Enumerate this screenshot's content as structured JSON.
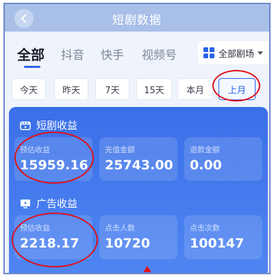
{
  "header": {
    "title": "短剧数据"
  },
  "platform_tabs": [
    "全部",
    "抖音",
    "快手",
    "视频号"
  ],
  "active_platform": "全部",
  "theater_select": {
    "value": "全部剧场",
    "icon": "grid-icon"
  },
  "time_tabs": [
    "今天",
    "昨天",
    "7天",
    "15天",
    "本月",
    "上月"
  ],
  "active_time_tab": "上月",
  "drama_income": {
    "title": "短剧收益",
    "icon": "film-icon",
    "metrics": [
      {
        "label": "预估收益",
        "value": "15959.16"
      },
      {
        "label": "充值金额",
        "value": "25743.00"
      },
      {
        "label": "退款金额",
        "value": "0.00"
      }
    ]
  },
  "ad_income": {
    "title": "广告收益",
    "icon": "monitor-icon",
    "metrics": [
      {
        "label": "预估收益",
        "value": "2218.17"
      },
      {
        "label": "点击人数",
        "value": "10720"
      },
      {
        "label": "点击次数",
        "value": "100147"
      }
    ]
  },
  "annotation_color": "#e0101a",
  "accent_color": "#2a63e8"
}
